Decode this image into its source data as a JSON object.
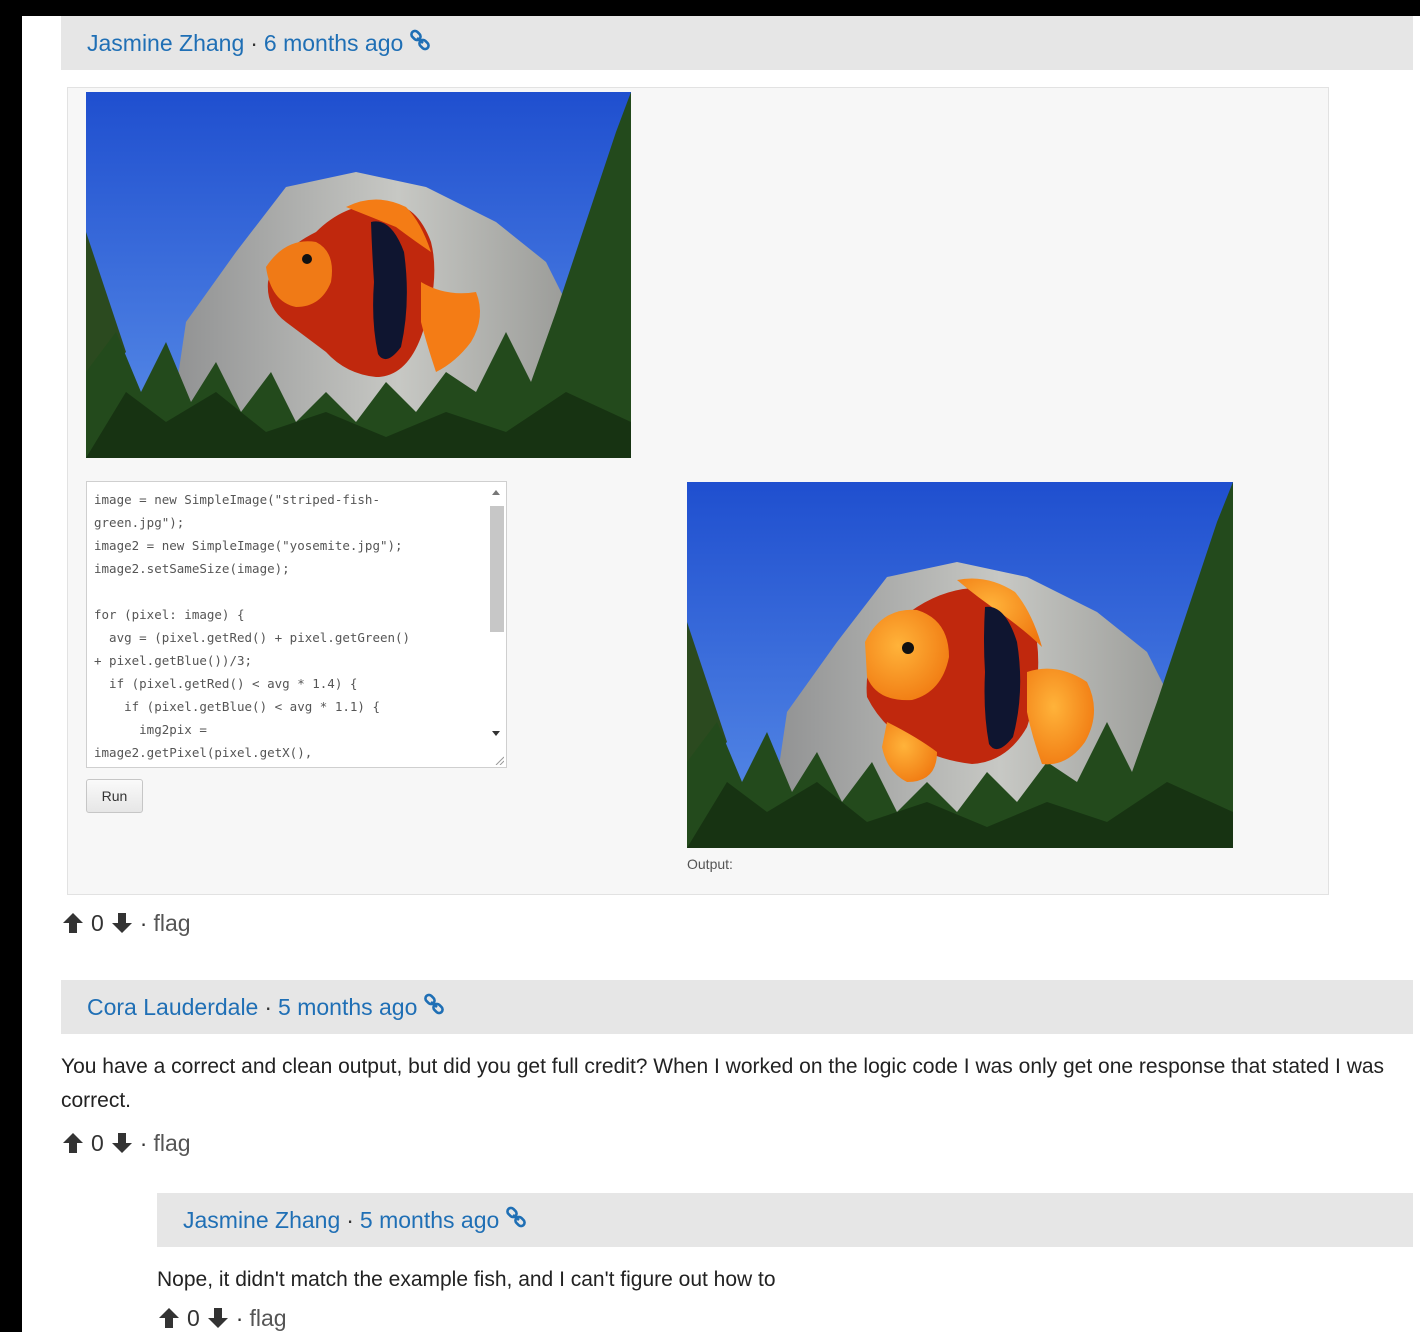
{
  "comments": [
    {
      "author": "Jasmine Zhang",
      "separator": "·",
      "time": "6 months ago",
      "votes": "0",
      "flag": "flag",
      "flag_separator": "·"
    },
    {
      "author": "Cora Lauderdale",
      "separator": "·",
      "time": "5 months ago",
      "body": "You have a correct and clean output, but did you get full credit? When I worked on the logic code I was only get one response that stated I was correct.",
      "votes": "0",
      "flag": "flag",
      "flag_separator": "·"
    },
    {
      "author": "Jasmine Zhang",
      "separator": "·",
      "time": "5 months ago",
      "body": "Nope, it didn't match the example fish, and I can't figure out how to",
      "votes": "0",
      "flag": "flag",
      "flag_separator": "·"
    }
  ],
  "editor": {
    "code_lines": [
      "image = new SimpleImage(\"striped-fish-",
      "green.jpg\");",
      "image2 = new SimpleImage(\"yosemite.jpg\");",
      "image2.setSameSize(image);",
      "",
      "for (pixel: image) {",
      "  avg = (pixel.getRed() + pixel.getGreen()",
      "+ pixel.getBlue())/3;",
      "  if (pixel.getRed() < avg * 1.4) {",
      "    if (pixel.getBlue() < avg * 1.1) {",
      "      img2pix =",
      "image2.getPixel(pixel.getX(),"
    ],
    "run_label": "Run",
    "output_label": "Output:"
  },
  "icons": {
    "link": "link-icon",
    "upvote": "arrow-up-icon",
    "downvote": "arrow-down-icon"
  },
  "colors": {
    "link": "#1f6fb5",
    "header_bg": "#e6e6e6",
    "panel_bg": "#f7f7f7"
  }
}
